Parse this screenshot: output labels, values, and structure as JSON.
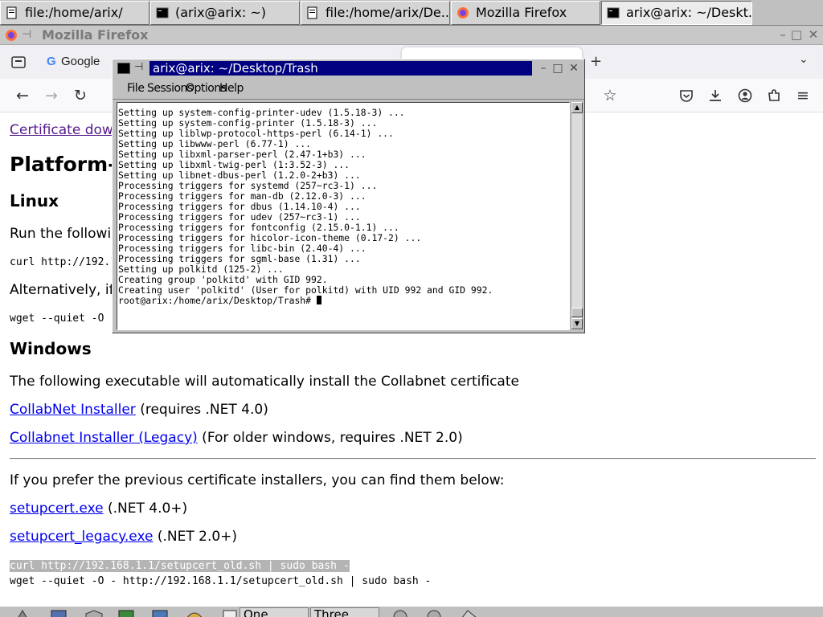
{
  "tasklist": {
    "tasks": [
      {
        "label": "file:/home/arix/",
        "icon": "file-browser-icon"
      },
      {
        "label": "(arix@arix: ~)",
        "icon": "terminal-icon"
      },
      {
        "label": "file:/home/arix/De...",
        "icon": "file-browser-icon"
      },
      {
        "label": "Mozilla Firefox",
        "icon": "firefox-icon"
      },
      {
        "label": "arix@arix: ~/Deskt...",
        "icon": "terminal-icon"
      }
    ]
  },
  "firefox": {
    "title": "Mozilla Firefox",
    "tab_label": "Google",
    "content": {
      "cert_link": "Certificate downl",
      "h1": "Platform-",
      "h2_linux": "Linux",
      "run_following": "Run the followin",
      "curl_line": "curl http://192.16",
      "alternatively": "Alternatively, if",
      "wget_line": "wget --quiet -O -",
      "h2_windows": "Windows",
      "windows_desc": "The following executable will automatically install the Collabnet certificate",
      "installer_link": "CollabNet Installer",
      "installer_note": " (requires .NET 4.0)",
      "legacy_link": "Collabnet Installer (Legacy)",
      "legacy_note": " (For older windows, requires .NET 2.0)",
      "prev_installers": "If you prefer the previous certificate installers, you can find them below:",
      "setupcert_link": "setupcert.exe",
      "setupcert_note": " (.NET 4.0+)",
      "setupcert_legacy_link": "setupcert_legacy.exe",
      "setupcert_legacy_note": " (.NET 2.0+)",
      "curl_old": "curl http://192.168.1.1/setupcert_old.sh | sudo bash -",
      "wget_old": "wget --quiet -O - http://192.168.1.1/setupcert_old.sh | sudo bash -"
    }
  },
  "terminal": {
    "title": "arix@arix: ~/Desktop/Trash",
    "menu": [
      "File",
      "Sessions",
      "Options",
      "Help"
    ],
    "lines": [
      "Setting up system-config-printer-udev (1.5.18-3) ...",
      "Setting up system-config-printer (1.5.18-3) ...",
      "Setting up liblwp-protocol-https-perl (6.14-1) ...",
      "Setting up libwww-perl (6.77-1) ...",
      "Setting up libxml-parser-perl (2.47-1+b3) ...",
      "Setting up libxml-twig-perl (1:3.52-3) ...",
      "Setting up libnet-dbus-perl (1.2.0-2+b3) ...",
      "Processing triggers for systemd (257~rc3-1) ...",
      "Processing triggers for man-db (2.12.0-3) ...",
      "Processing triggers for dbus (1.14.10-4) ...",
      "Processing triggers for udev (257~rc3-1) ...",
      "Processing triggers for fontconfig (2.15.0-1.1) ...",
      "Processing triggers for hicolor-icon-theme (0.17-2) ...",
      "Processing triggers for libc-bin (2.40-4) ...",
      "Processing triggers for sgml-base (1.31) ...",
      "Setting up polkitd (125-2) ...",
      "Creating group 'polkitd' with GID 992.",
      "Creating user 'polkitd' (User for polkitd) with UID 992 and GID 992."
    ],
    "prompt": "root@arix:/home/arix/Desktop/Trash# "
  },
  "bottombar": {
    "pager_one": "One",
    "pager_three": "Three"
  }
}
